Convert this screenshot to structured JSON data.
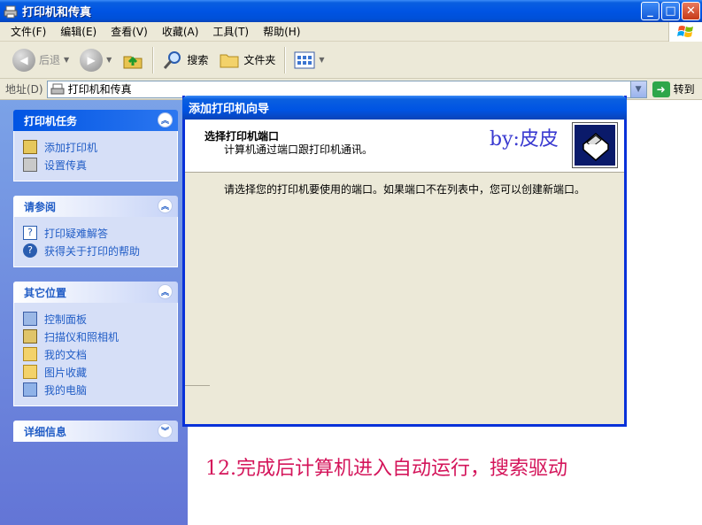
{
  "window": {
    "title": "打印机和传真"
  },
  "menu": [
    "文件(F)",
    "编辑(E)",
    "查看(V)",
    "收藏(A)",
    "工具(T)",
    "帮助(H)"
  ],
  "toolbar": {
    "back": "后退",
    "search": "搜索",
    "folders": "文件夹"
  },
  "address": {
    "label": "地址(D)",
    "value": "打印机和传真",
    "go": "转到"
  },
  "sidebar": {
    "tasks": {
      "title": "打印机任务",
      "items": [
        "添加打印机",
        "设置传真"
      ]
    },
    "see_also": {
      "title": "请参阅",
      "items": [
        "打印疑难解答",
        "获得关于打印的帮助"
      ]
    },
    "other_places": {
      "title": "其它位置",
      "items": [
        "控制面板",
        "扫描仪和照相机",
        "我的文档",
        "图片收藏",
        "我的电脑"
      ]
    },
    "details": {
      "title": "详细信息"
    }
  },
  "wizard": {
    "title": "添加打印机向导",
    "heading": "选择打印机端口",
    "subheading": "计算机通过端口跟打印机通讯。",
    "byline": "by:皮皮",
    "body": "请选择您的打印机要使用的端口。如果端口不在列表中，您可以创建新端口。"
  },
  "caption": "12.完成后计算机进入自动运行，搜索驱动",
  "colors": {
    "title_blue": "#0054e3",
    "caption": "#d4145a",
    "byline": "#3a3ad0"
  }
}
